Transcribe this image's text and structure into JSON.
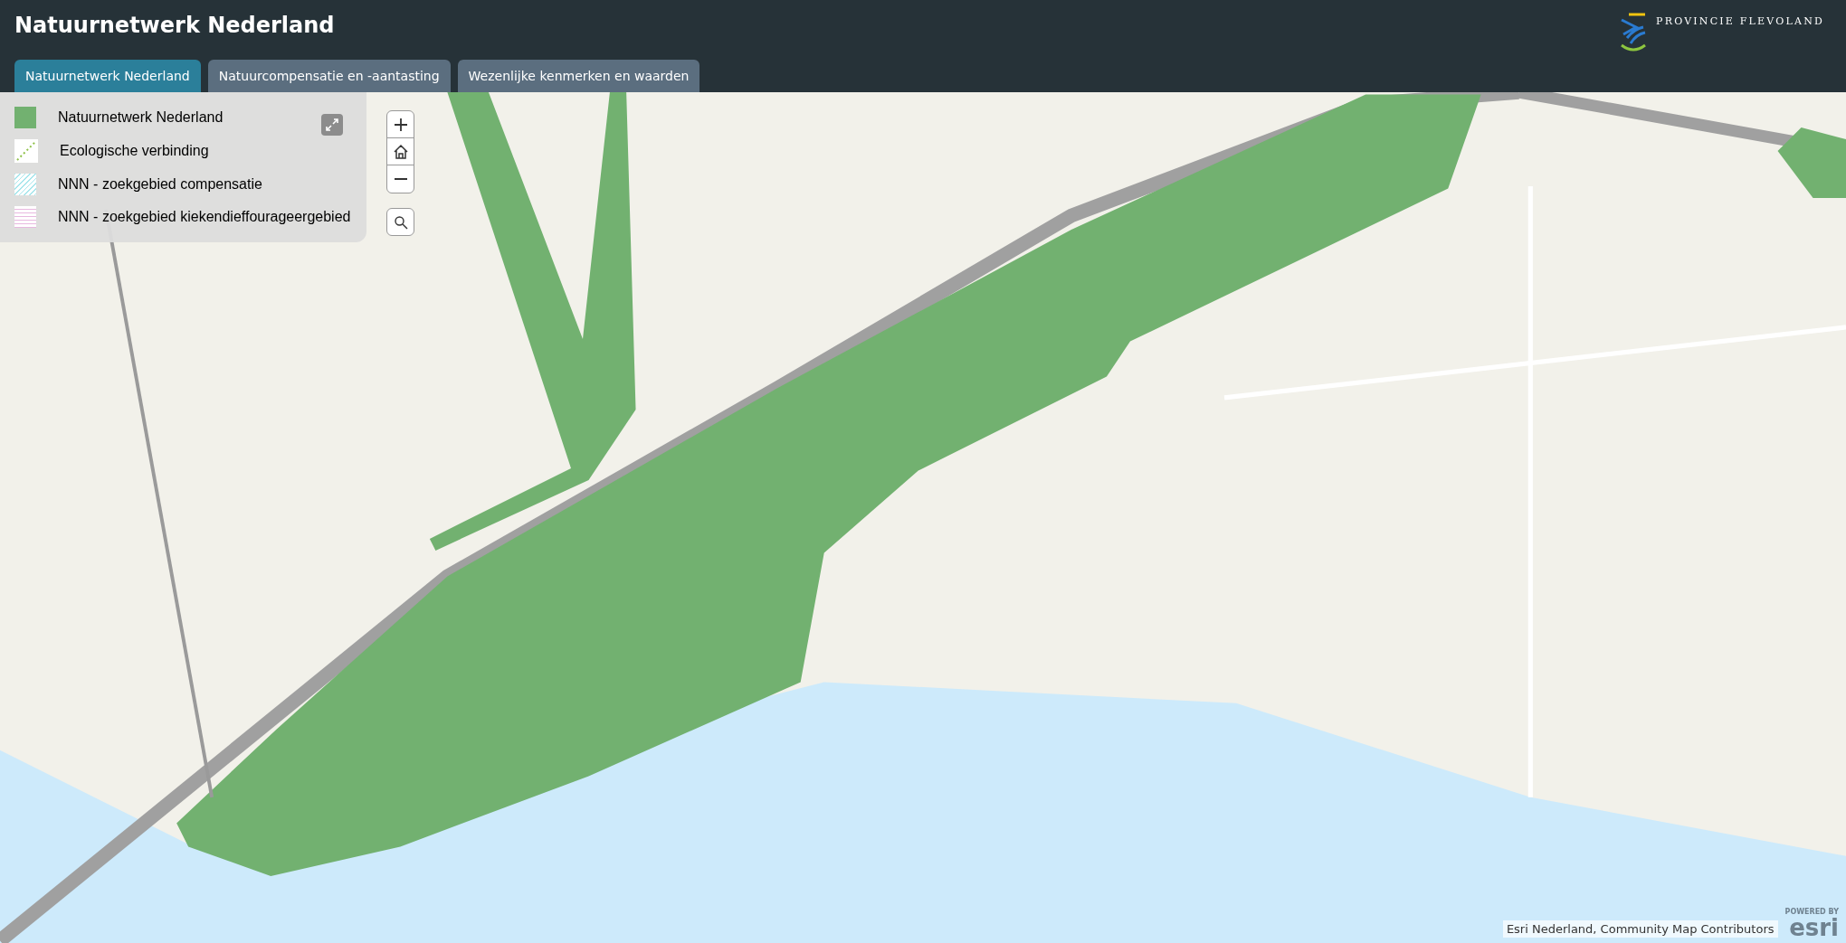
{
  "header": {
    "title": "Natuurnetwerk Nederland",
    "logo_text": "PROVINCIE FLEVOLAND"
  },
  "tabs": [
    {
      "label": "Natuurnetwerk Nederland",
      "selected": true
    },
    {
      "label": "Natuurcompensatie en -aantasting",
      "selected": false
    },
    {
      "label": "Wezenlijke kenmerken en waarden",
      "selected": false
    }
  ],
  "legend": {
    "items": [
      {
        "kind": "fill",
        "label": "Natuurnetwerk Nederland"
      },
      {
        "kind": "dotted",
        "label": "Ecologische verbinding"
      },
      {
        "kind": "diagonal",
        "label": "NNN - zoekgebied compensatie"
      },
      {
        "kind": "horizontal",
        "label": "NNN - zoekgebied kiekendieffourageergebied"
      }
    ]
  },
  "attribution": "Esri Nederland, Community Map Contributors",
  "esri_logo": {
    "caption": "POWERED BY",
    "name": "esri"
  }
}
